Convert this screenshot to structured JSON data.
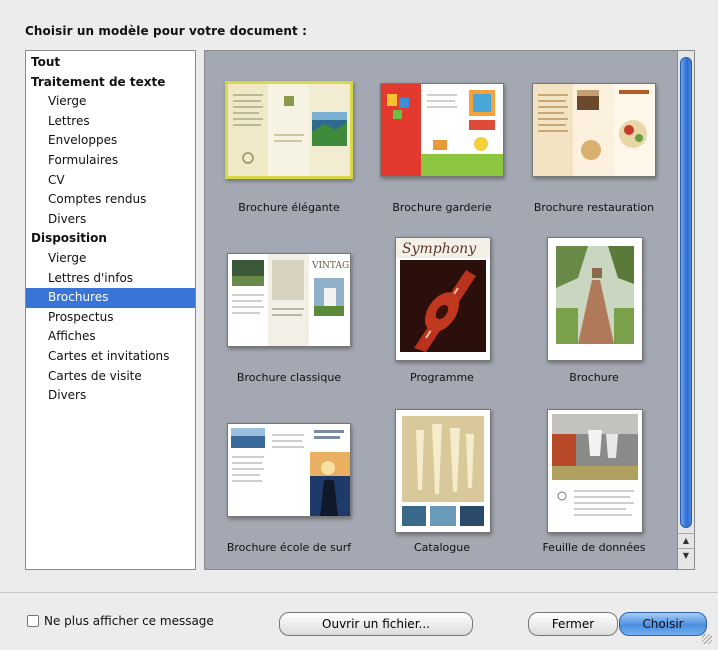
{
  "dialog": {
    "title": "Choisir un modèle pour votre document :"
  },
  "sidebar": {
    "items": [
      {
        "label": "Tout",
        "type": "header"
      },
      {
        "label": "Traitement de texte",
        "type": "header"
      },
      {
        "label": "Vierge",
        "type": "item"
      },
      {
        "label": "Lettres",
        "type": "item"
      },
      {
        "label": "Enveloppes",
        "type": "item"
      },
      {
        "label": "Formulaires",
        "type": "item"
      },
      {
        "label": "CV",
        "type": "item"
      },
      {
        "label": "Comptes rendus",
        "type": "item"
      },
      {
        "label": "Divers",
        "type": "item"
      },
      {
        "label": "Disposition",
        "type": "header"
      },
      {
        "label": "Vierge",
        "type": "item"
      },
      {
        "label": "Lettres d'infos",
        "type": "item"
      },
      {
        "label": "Brochures",
        "type": "item",
        "selected": true
      },
      {
        "label": "Prospectus",
        "type": "item"
      },
      {
        "label": "Affiches",
        "type": "item"
      },
      {
        "label": "Cartes et invitations",
        "type": "item"
      },
      {
        "label": "Cartes de visite",
        "type": "item"
      },
      {
        "label": "Divers",
        "type": "item"
      }
    ]
  },
  "templates": [
    {
      "label": "Brochure élégante",
      "selected": true
    },
    {
      "label": "Brochure garderie"
    },
    {
      "label": "Brochure restauration"
    },
    {
      "label": "Brochure classique"
    },
    {
      "label": "Programme",
      "thumb_text": "Symphony"
    },
    {
      "label": "Brochure"
    },
    {
      "label": "Brochure école de surf"
    },
    {
      "label": "Catalogue"
    },
    {
      "label": "Feuille de données"
    }
  ],
  "thumb_text": {
    "vintage": "VINTAGE"
  },
  "footer": {
    "checkbox_label": "Ne plus afficher ce message",
    "open_file_label": "Ouvrir un fichier...",
    "close_label": "Fermer",
    "choose_label": "Choisir"
  },
  "colors": {
    "selection": "#3875d7",
    "gallery_bg": "#a4a8b2",
    "primary_button": "#4b8ee0"
  }
}
